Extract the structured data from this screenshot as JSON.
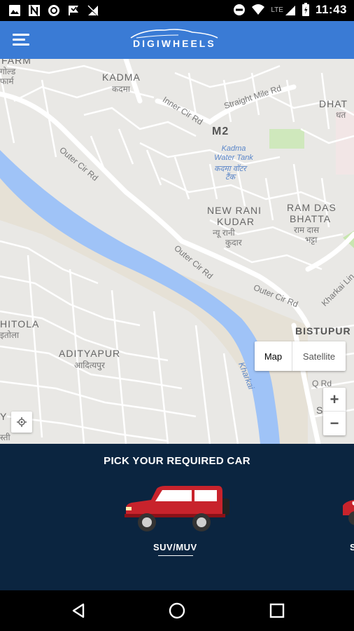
{
  "status_bar": {
    "time": "11:43",
    "network": "LTE",
    "left_icons": [
      "image-icon",
      "n-icon",
      "shield-icon",
      "flag-icon",
      "signal-off-icon"
    ],
    "right_icons": [
      "dnd-icon",
      "wifi-icon",
      "cell-signal-icon",
      "battery-icon"
    ]
  },
  "app_bar": {
    "brand": "DIGIWHEELS",
    "menu_icon": "hamburger-menu-icon",
    "color": "#3a7bd5"
  },
  "map": {
    "labels": {
      "kadma": "KADMA",
      "kadma_hi": "कदमा",
      "farm": "FARM",
      "farm_hi1": "गोल्ड",
      "farm_hi2": "फार्म",
      "inner_cir": "Inner Cir Rd",
      "straight_mile": "Straight Mile Rd",
      "dhat": "DHAT",
      "dhat_hi": "धत",
      "m2": "M2",
      "water_tank": "Kadma Water Tank",
      "water_tank_hi1": "कदमा वॉटर",
      "water_tank_hi2": "टैंक",
      "outer_cir_1": "Outer Cir Rd",
      "outer_cir_2": "Outer Cir Rd",
      "outer_cir_3": "Outer Cir Rd",
      "new_rani": "NEW RANI",
      "kudar": "KUDAR",
      "new_rani_hi": "न्यू रानी",
      "kudar_hi": "कुदार",
      "ram_das": "RAM DAS",
      "bhatta": "BHATTA",
      "ram_das_hi": "राम दास",
      "bhatta_hi": "भट्टा",
      "kharkai_link": "Kharkai Lin",
      "bistupur": "BISTUPUR",
      "hitola": "HITOLA",
      "hitola_hi": "इतोला",
      "adityapur": "ADITYAPUR",
      "adityapur_hi": "आदित्यपुर",
      "kharkai": "Kharkai",
      "q_rd": "Q Rd",
      "s_label": "S",
      "basti": "Y   STI",
      "basti_hi": "स्ती"
    },
    "map_type": {
      "map": "Map",
      "satellite": "Satellite",
      "selected": "Map"
    },
    "zoom_in": "+",
    "zoom_out": "−",
    "colors": {
      "land": "#e9e8e5",
      "road": "#ffffff",
      "river": "#9fc3f7",
      "park": "#c8e6b0"
    }
  },
  "car_picker": {
    "title": "PICK YOUR REQUIRED CAR",
    "cars": [
      {
        "label": "SUV/MUV",
        "icon": "suv-car-icon",
        "selected": true
      },
      {
        "label": "S",
        "icon": "sedan-car-icon",
        "selected": false
      }
    ],
    "car_color": "#c8232c",
    "background": "#0b2540"
  },
  "nav_bar": {
    "back_icon": "back-triangle-icon",
    "home_icon": "home-circle-icon",
    "recents_icon": "recents-square-icon"
  }
}
